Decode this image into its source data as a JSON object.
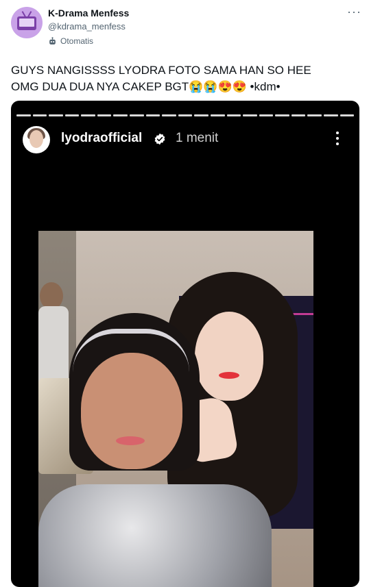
{
  "tweet": {
    "display_name": "K-Drama Menfess",
    "handle": "@kdrama_menfess",
    "automated_label": "Otomatis",
    "more_label": "···",
    "text": "GUYS NANGISSSS LYODRA FOTO SAMA HAN SO HEE\nOMG DUA DUA NYA CAKEP BGT😭😭😍😍 •kdm•"
  },
  "story": {
    "username": "lyodraofficial",
    "time": "1 menit",
    "progress_segments": 21
  },
  "colors": {
    "text_primary": "#0f1419",
    "text_secondary": "#536471",
    "media_background": "#000000",
    "avatar_background": "#c9a2e8"
  }
}
